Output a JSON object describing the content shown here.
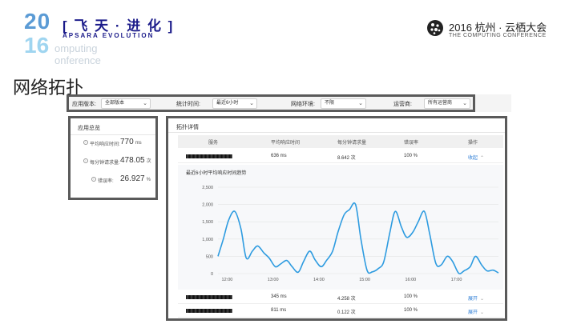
{
  "slide": {
    "logo_left": {
      "year_top": "20",
      "year_bottom": "16",
      "cn_text": "[ 飞 天 · 进 化 ]",
      "en_text": "APSARA EVOLUTION",
      "sub1": "omputing",
      "sub2": "onference"
    },
    "logo_right": {
      "line1": "2016 杭州 · 云栖大会",
      "line2": "THE COMPUTING CONFERENCE"
    },
    "title": "网络拓扑"
  },
  "filters": [
    {
      "label": "应用版本:",
      "value": "全部版本"
    },
    {
      "label": "统计时间:",
      "value": "最近6小时"
    },
    {
      "label": "网络环境:",
      "value": "不限"
    },
    {
      "label": "运营商:",
      "value": "所有运营商"
    }
  ],
  "overview": {
    "title": "应用总览",
    "rows": [
      {
        "label": "平均响应时间:",
        "value": "770",
        "unit": "ms"
      },
      {
        "label": "每分钟请求量:",
        "value": "478.05",
        "unit": "次"
      },
      {
        "label": "错误率:",
        "value": "26.927",
        "unit": "%"
      }
    ]
  },
  "detail": {
    "title": "拓扑详情",
    "columns": [
      "服务",
      "平均响应时间",
      "每分钟请求量",
      "错误率",
      "操作"
    ],
    "rows": [
      {
        "response_time": "636 ms",
        "requests": "8.642 次",
        "error_rate": "100 %",
        "action": "收起",
        "chevron": "⌃"
      },
      {
        "response_time": "345 ms",
        "requests": "4.258 次",
        "error_rate": "100 %",
        "action": "展开",
        "chevron": "⌄"
      },
      {
        "response_time": "811 ms",
        "requests": "0.122 次",
        "error_rate": "100 %",
        "action": "展开",
        "chevron": "⌄"
      }
    ]
  },
  "chart_data": {
    "type": "line",
    "title": "最近6小时平均响应时间趋势",
    "xlabel": "",
    "ylabel": "",
    "x_ticks": [
      "12:00",
      "13:00",
      "14:00",
      "15:00",
      "16:00",
      "17:00"
    ],
    "y_ticks": [
      "0",
      "500",
      "1,000",
      "1,500",
      "2,000",
      "2,500"
    ],
    "ylim": [
      0,
      2500
    ],
    "xlim": [
      "11:48",
      "17:55"
    ],
    "grid": true,
    "color": "#2d9be0",
    "series": [
      {
        "x": [
          "11:48",
          "11:55",
          "12:02",
          "12:10",
          "12:18",
          "12:25",
          "12:33",
          "12:40",
          "12:48",
          "12:55",
          "13:03",
          "13:10",
          "13:18",
          "13:25",
          "13:33",
          "13:40",
          "13:48",
          "13:55",
          "14:03",
          "14:10",
          "14:18",
          "14:25",
          "14:33",
          "14:40",
          "14:48",
          "14:55",
          "15:03",
          "15:10",
          "15:18",
          "15:25",
          "15:33",
          "15:40",
          "15:48",
          "15:55",
          "16:03",
          "16:10",
          "16:18",
          "16:25",
          "16:33",
          "16:40",
          "16:48",
          "16:55",
          "17:03",
          "17:10",
          "17:18",
          "17:25",
          "17:33",
          "17:40",
          "17:48",
          "17:55"
        ],
        "values": [
          500,
          1000,
          1550,
          1800,
          1300,
          450,
          650,
          800,
          600,
          450,
          200,
          280,
          380,
          200,
          40,
          350,
          650,
          400,
          200,
          380,
          650,
          1200,
          1700,
          1850,
          2000,
          1000,
          100,
          50,
          150,
          350,
          1200,
          1800,
          1350,
          1050,
          1200,
          1500,
          1800,
          1150,
          300,
          250,
          500,
          350,
          10,
          80,
          200,
          500,
          250,
          80,
          100,
          20
        ]
      }
    ]
  }
}
